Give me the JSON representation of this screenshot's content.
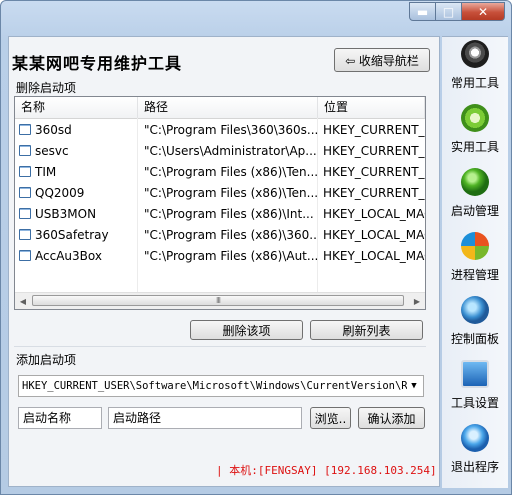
{
  "window": {
    "title": "",
    "minimize": "▬",
    "maximize": "□",
    "close": "✕"
  },
  "header": {
    "title": "某某网吧专用维护工具",
    "collapse_button": "⇦ 收缩导航栏"
  },
  "startup_delete": {
    "section_label": "删除启动项",
    "columns": [
      "名称",
      "路径",
      "位置"
    ],
    "rows": [
      {
        "name": "360sd",
        "path": "\"C:\\Program Files\\360\\360s...",
        "location": "HKEY_CURRENT_U"
      },
      {
        "name": "sesvc",
        "path": "\"C:\\Users\\Administrator\\Ap...",
        "location": "HKEY_CURRENT_U"
      },
      {
        "name": "TIM",
        "path": "\"C:\\Program Files (x86)\\Ten...",
        "location": "HKEY_CURRENT_U"
      },
      {
        "name": "QQ2009",
        "path": "\"C:\\Program Files (x86)\\Ten...",
        "location": "HKEY_CURRENT_U"
      },
      {
        "name": "USB3MON",
        "path": "\"C:\\Program Files (x86)\\Int...",
        "location": "HKEY_LOCAL_MAC"
      },
      {
        "name": "360Safetray",
        "path": "\"C:\\Program Files (x86)\\360...",
        "location": "HKEY_LOCAL_MAC"
      },
      {
        "name": "AccAu3Box",
        "path": "\"C:\\Program Files (x86)\\Aut...",
        "location": "HKEY_LOCAL_MAC"
      }
    ],
    "scroll_left": "◀",
    "scroll_right": "▶",
    "scroll_grip": "III",
    "delete_button": "删除该项",
    "refresh_button": "刷新列表"
  },
  "startup_add": {
    "section_label": "添加启动项",
    "registry_key": "HKEY_CURRENT_USER\\Software\\Microsoft\\Windows\\CurrentVersion\\Run",
    "dropdown_arrow": "▼",
    "name_field": "启动名称",
    "path_field": "启动路径",
    "browse_button": "浏览..",
    "confirm_button": "确认添加"
  },
  "status": {
    "text": "| 本机:[FENGSAY] [192.168.103.254]"
  },
  "sidebar": {
    "items": [
      {
        "label": "常用工具",
        "icon": "cd-tools-icon",
        "color": "#3a3a3a"
      },
      {
        "label": "实用工具",
        "icon": "green-gear-icon",
        "color": "#5fb82a"
      },
      {
        "label": "启动管理",
        "icon": "green-power-icon",
        "color": "#3d9a2a"
      },
      {
        "label": "进程管理",
        "icon": "windows-logo-icon",
        "color": "#e08a1c"
      },
      {
        "label": "控制面板",
        "icon": "control-panel-globe-icon",
        "color": "#3a8fd1"
      },
      {
        "label": "工具设置",
        "icon": "monitor-settings-icon",
        "color": "#2a74c8"
      },
      {
        "label": "退出程序",
        "icon": "exit-windows-icon",
        "color": "#2e86d6"
      }
    ]
  }
}
